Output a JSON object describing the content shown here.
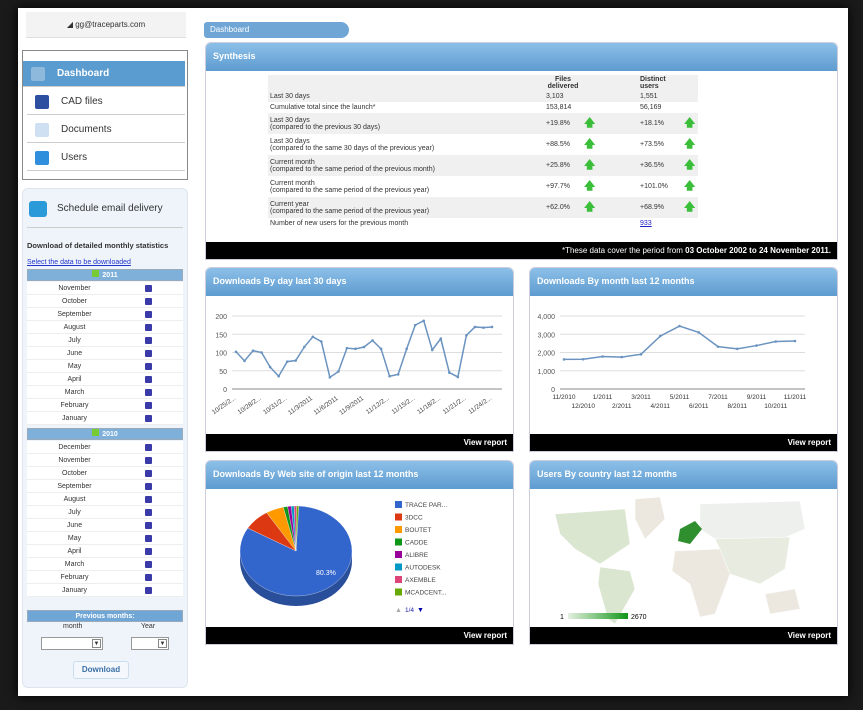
{
  "user": {
    "email": "gg@traceparts.com"
  },
  "nav": [
    {
      "label": "Dashboard",
      "icon": "dashboard-icon"
    },
    {
      "label": "CAD files",
      "icon": "cad-files-icon"
    },
    {
      "label": "Documents",
      "icon": "documents-icon"
    },
    {
      "label": "Users",
      "icon": "users-icon"
    }
  ],
  "sidebar": {
    "schedule": "Schedule email delivery",
    "download_title": "Download of detailed monthly statistics",
    "select_link": "Select the data to be downloaded",
    "years": [
      {
        "year": "2011",
        "months": [
          "November",
          "October",
          "September",
          "August",
          "July",
          "June",
          "May",
          "April",
          "March",
          "February",
          "January"
        ]
      },
      {
        "year": "2010",
        "months": [
          "December",
          "November",
          "October",
          "September",
          "August",
          "July",
          "June",
          "May",
          "April",
          "March",
          "February",
          "January"
        ]
      }
    ],
    "previous_months": "Previous months:",
    "month_label": "month",
    "year_label": "Year",
    "download_button": "Download"
  },
  "breadcrumb": "Dashboard",
  "synthesis": {
    "title": "Synthesis",
    "col_files": "Files delivered",
    "col_users": "Distinct users",
    "rows": [
      {
        "l1": "Last 30 days",
        "l2": "",
        "files": "3,103",
        "users": "1,551",
        "arrows": false
      },
      {
        "l1": "Cumulative total since the launch*",
        "l2": "",
        "files": "153,814",
        "users": "56,169",
        "arrows": false
      },
      {
        "l1": "Last 30 days",
        "l2": "(compared to the previous 30 days)",
        "files": "+19.8%",
        "users": "+18.1%",
        "arrows": true
      },
      {
        "l1": "Last 30 days",
        "l2": "(compared to the same 30 days of the previous year)",
        "files": "+88.5%",
        "users": "+73.5%",
        "arrows": true
      },
      {
        "l1": "Current month",
        "l2": "(compared to the same period of the previous month)",
        "files": "+25.8%",
        "users": "+36.5%",
        "arrows": true
      },
      {
        "l1": "Current month",
        "l2": "(compared to the same period of the previous year)",
        "files": "+97.7%",
        "users": "+101.0%",
        "arrows": true
      },
      {
        "l1": "Current year",
        "l2": "(compared to the same period of the previous year)",
        "files": "+62.0%",
        "users": "+68.9%",
        "arrows": true
      },
      {
        "l1": "Number of new users for the previous month",
        "l2": "",
        "files": "",
        "users": "933",
        "arrows": false,
        "link": true
      }
    ],
    "footnote_prefix": "*These data cover the period from ",
    "footnote_bold": "03 October 2002 to 24 November 2011."
  },
  "view_report": "View report",
  "panels": {
    "daily": "Downloads By day last 30 days",
    "monthly": "Downloads By month last 12 months",
    "website": "Downloads By Web site of origin last 12 months",
    "country": "Users By country last 12 months"
  },
  "chart_data": [
    {
      "type": "line",
      "title": "Downloads By day last 30 days",
      "ylim": [
        0,
        200
      ],
      "yticks": [
        "0",
        "50",
        "100",
        "150",
        "200"
      ],
      "x": [
        "10/25/2011",
        "10/26/2011",
        "10/27/2011",
        "10/28/2011",
        "10/29/2011",
        "10/30/2011",
        "10/31/2011",
        "11/1/2011",
        "11/2/2011",
        "11/3/2011",
        "11/4/2011",
        "11/5/2011",
        "11/6/2011",
        "11/7/2011",
        "11/8/2011",
        "11/9/2011",
        "11/10/2011",
        "11/11/2011",
        "11/12/2011",
        "11/13/2011",
        "11/14/2011",
        "11/15/2011",
        "11/16/2011",
        "11/17/2011",
        "11/18/2011",
        "11/19/2011",
        "11/20/2011",
        "11/21/2011",
        "11/22/2011",
        "11/23/2011",
        "11/24/2011"
      ],
      "xticklabels": [
        "10/25/2...",
        "10/28/2...",
        "10/31/2...",
        "11/3/2011",
        "11/6/2011",
        "11/9/2011",
        "11/12/2...",
        "11/15/2...",
        "11/18/2...",
        "11/21/2...",
        "11/24/2..."
      ],
      "values": [
        102,
        77,
        105,
        100,
        60,
        35,
        75,
        78,
        115,
        143,
        130,
        32,
        48,
        112,
        110,
        115,
        133,
        110,
        35,
        40,
        110,
        175,
        187,
        107,
        138,
        45,
        33,
        147,
        170,
        168,
        170
      ],
      "color": "#6a93c0"
    },
    {
      "type": "line",
      "title": "Downloads By month last 12 months",
      "ylim": [
        0,
        4000
      ],
      "yticks": [
        "0",
        "1,000",
        "2,000",
        "3,000",
        "4,000"
      ],
      "x": [
        "11/2010",
        "12/2010",
        "1/2011",
        "2/2011",
        "3/2011",
        "4/2011",
        "5/2011",
        "6/2011",
        "7/2011",
        "8/2011",
        "9/2011",
        "10/2011",
        "11/2011"
      ],
      "values": [
        1620,
        1630,
        1780,
        1750,
        1900,
        2900,
        3450,
        3100,
        2320,
        2200,
        2380,
        2600,
        2630
      ],
      "color": "#6a93c0"
    },
    {
      "type": "pie",
      "title": "Downloads By Web site of origin last 12 months",
      "labels": [
        "TRACE PAR...",
        "3DCC",
        "BOUTET",
        "CADDE",
        "ALIBRE",
        "AUTODESK",
        "AXEMBLE",
        "MCADCENT..."
      ],
      "values": [
        80.3,
        7.5,
        5.0,
        1.2,
        1.0,
        0.8,
        0.7,
        0.6
      ],
      "colors": [
        "#3366cc",
        "#dc3912",
        "#ff9900",
        "#109618",
        "#990099",
        "#0099c6",
        "#dd4477",
        "#66aa00"
      ],
      "slice_label": "80.3%",
      "page": "1/4"
    },
    {
      "type": "map",
      "title": "Users By country last 12 months",
      "legend_min": "1",
      "legend_max": "2670",
      "color_min": "#e6f0e0",
      "color_max": "#109618"
    }
  ]
}
